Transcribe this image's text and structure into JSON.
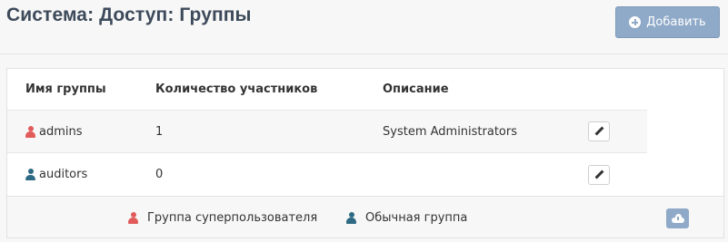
{
  "header": {
    "title": "Система: Доступ: Группы",
    "add_button_label": "Добавить"
  },
  "table": {
    "columns": [
      "Имя группы",
      "Количество участников",
      "Описание"
    ],
    "rows": [
      {
        "name": "admins",
        "members": "1",
        "description": "System Administrators",
        "type": "superuser"
      },
      {
        "name": "auditors",
        "members": "0",
        "description": "",
        "type": "normal"
      }
    ]
  },
  "legend": {
    "superuser_label": "Группа суперпользователя",
    "normal_label": "Обычная группа"
  },
  "colors": {
    "accent": "#8fa9c8",
    "superuser": "#e25b5b",
    "normal": "#2f6a84",
    "title": "#3d4a5a"
  },
  "icons": {
    "add": "plus-circle-icon",
    "superuser": "user-icon",
    "normal": "user-icon",
    "edit": "pencil-icon",
    "download": "cloud-download-icon"
  }
}
